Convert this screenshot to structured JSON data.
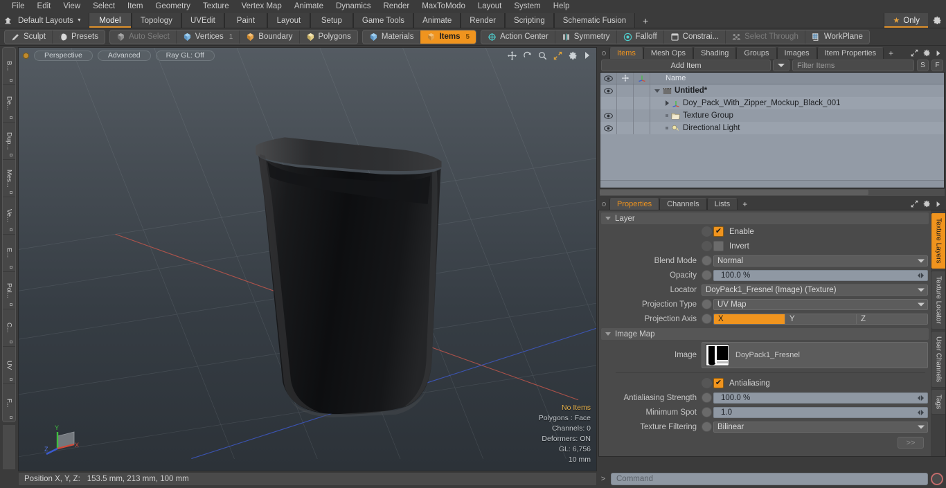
{
  "menubar": {
    "items": [
      "File",
      "Edit",
      "View",
      "Select",
      "Item",
      "Geometry",
      "Texture",
      "Vertex Map",
      "Animate",
      "Dynamics",
      "Render",
      "MaxToModo",
      "Layout",
      "System",
      "Help"
    ]
  },
  "layoutbar": {
    "layout_name": "Default Layouts",
    "home_icon": "home-icon",
    "tabs": [
      {
        "label": "Model",
        "active": true
      },
      {
        "label": "Topology",
        "active": false
      },
      {
        "label": "UVEdit",
        "active": false
      },
      {
        "label": "Paint",
        "active": false
      },
      {
        "label": "Layout",
        "active": false
      },
      {
        "label": "Setup",
        "active": false
      },
      {
        "label": "Game Tools",
        "active": false
      },
      {
        "label": "Animate",
        "active": false
      },
      {
        "label": "Render",
        "active": false
      },
      {
        "label": "Scripting",
        "active": false
      },
      {
        "label": "Schematic Fusion",
        "active": false
      }
    ],
    "add_tab_label": "+",
    "only_label": "Only",
    "star_icon": "star-icon",
    "gear_icon": "gear-icon"
  },
  "modebar": {
    "group1": [
      {
        "label": "Sculpt",
        "icon": "pencil-icon",
        "state": "normal"
      },
      {
        "label": "Presets",
        "icon": "sphere-icon",
        "state": "normal"
      }
    ],
    "group2": [
      {
        "label": "Auto Select",
        "icon": "cube-grey-icon",
        "state": "dim",
        "count": ""
      },
      {
        "label": "Vertices",
        "icon": "cube-blue-icon",
        "state": "normal",
        "count": "1"
      },
      {
        "label": "Boundary",
        "icon": "cube-orange-icon",
        "state": "normal",
        "count": ""
      },
      {
        "label": "Polygons",
        "icon": "cube-yellow-icon",
        "state": "normal",
        "count": ""
      }
    ],
    "group3": [
      {
        "label": "Materials",
        "icon": "cube-blue-icon",
        "state": "normal",
        "count": ""
      },
      {
        "label": "Items",
        "icon": "cube-orange-icon",
        "state": "selected",
        "count": "5"
      }
    ],
    "group4": [
      {
        "label": "Action Center",
        "icon": "target-icon",
        "state": "normal"
      },
      {
        "label": "Symmetry",
        "icon": "mirror-icon",
        "state": "normal"
      },
      {
        "label": "Falloff",
        "icon": "circle-target-icon",
        "state": "normal"
      },
      {
        "label": "Constrai...",
        "icon": "square-icon",
        "state": "normal"
      },
      {
        "label": "Select Through",
        "icon": "people-icon",
        "state": "dim"
      },
      {
        "label": "WorkPlane",
        "icon": "grid-icon",
        "state": "normal"
      }
    ]
  },
  "left_vtabs": [
    "B...",
    "De...",
    "Dup...",
    "Mes...",
    "Ve...",
    "E...",
    "Pol...",
    "C...",
    "UV",
    "F..."
  ],
  "viewport": {
    "pills": [
      "Perspective",
      "Advanced",
      "Ray GL: Off"
    ],
    "icons": [
      "move-icon",
      "rotate-icon",
      "zoom-icon",
      "maximize-icon",
      "gear-icon",
      "play-icon"
    ],
    "stats": [
      {
        "text": "No Items",
        "highlight": true
      },
      {
        "text": "Polygons : Face",
        "highlight": false
      },
      {
        "text": "Channels: 0",
        "highlight": false
      },
      {
        "text": "Deformers: ON",
        "highlight": false
      },
      {
        "text": "GL: 6,756",
        "highlight": false
      },
      {
        "text": "10 mm",
        "highlight": false
      }
    ],
    "gizmo_axes": [
      "X",
      "Y",
      "Z"
    ]
  },
  "items_panel": {
    "tabs": [
      {
        "label": "Items",
        "active": true
      },
      {
        "label": "Mesh Ops",
        "active": false
      },
      {
        "label": "Shading",
        "active": false
      },
      {
        "label": "Groups",
        "active": false
      },
      {
        "label": "Images",
        "active": false
      },
      {
        "label": "Item Properties",
        "active": false
      }
    ],
    "add_tab_label": "+",
    "add_item_label": "Add Item",
    "filter_placeholder": "Filter Items",
    "small_buttons": [
      "S",
      "F"
    ],
    "columns": {
      "eye": "eye-icon",
      "lock": "move-lock-icon",
      "axis": "axis-icon",
      "name": "Name"
    },
    "rows": [
      {
        "name": "Untitled*",
        "level": 0,
        "bold": true,
        "eye": true,
        "expander": "down",
        "icon": "scene-icon"
      },
      {
        "name": "Doy_Pack_With_Zipper_Mockup_Black_001",
        "level": 1,
        "bold": false,
        "eye": false,
        "expander": "right",
        "icon": "mesh-axis-icon"
      },
      {
        "name": "Texture Group",
        "level": 1,
        "bold": false,
        "eye": true,
        "expander": "none",
        "icon": "folder-icon"
      },
      {
        "name": "Directional Light",
        "level": 1,
        "bold": false,
        "eye": true,
        "expander": "none",
        "icon": "light-icon"
      }
    ]
  },
  "properties_panel": {
    "tabs": [
      {
        "label": "Properties",
        "active": true
      },
      {
        "label": "Channels",
        "active": false
      },
      {
        "label": "Lists",
        "active": false
      }
    ],
    "add_tab_label": "+",
    "sections": [
      {
        "title": "Layer",
        "rows": [
          {
            "type": "checkbox",
            "label": "Enable",
            "checked": true
          },
          {
            "type": "checkbox",
            "label": "Invert",
            "checked": false
          },
          {
            "type": "dropdown",
            "label": "Blend Mode",
            "value": "Normal"
          },
          {
            "type": "slider",
            "label": "Opacity",
            "value": "100.0 %"
          },
          {
            "type": "dropdown_nokn",
            "label": "Locator",
            "value": "DoyPack1_Fresnel (Image) (Texture)"
          },
          {
            "type": "dropdown",
            "label": "Projection Type",
            "value": "UV Map"
          },
          {
            "type": "axis",
            "label": "Projection Axis",
            "options": [
              "X",
              "Y",
              "Z"
            ],
            "selected": "X"
          }
        ]
      },
      {
        "title": "Image Map",
        "rows": [
          {
            "type": "image",
            "label": "Image",
            "value": "DoyPack1_Fresnel"
          },
          {
            "type": "checkbox",
            "label": "Antialiasing",
            "checked": true
          },
          {
            "type": "slider",
            "label": "Antialiasing Strength",
            "value": "100.0 %"
          },
          {
            "type": "slider",
            "label": "Minimum Spot",
            "value": "1.0"
          },
          {
            "type": "dropdown",
            "label": "Texture Filtering",
            "value": "Bilinear"
          }
        ]
      }
    ],
    "expand_button_label": ">>",
    "right_tabs": [
      {
        "label": "Texture Layers",
        "active": true
      },
      {
        "label": "Texture Locator",
        "active": false
      },
      {
        "label": "User Channels",
        "active": false
      },
      {
        "label": "Tags",
        "active": false
      }
    ]
  },
  "bottombar": {
    "position_label": "Position X, Y, Z:",
    "position_value": "153.5 mm, 213 mm, 100 mm",
    "command_chevron": ">",
    "command_placeholder": "Command",
    "record_icon": "record-icon"
  },
  "colors": {
    "accent": "#f0941e",
    "panel_bg": "#3b3b3b",
    "list_bg": "#939ba6",
    "field_bg": "#5c5c5c"
  }
}
